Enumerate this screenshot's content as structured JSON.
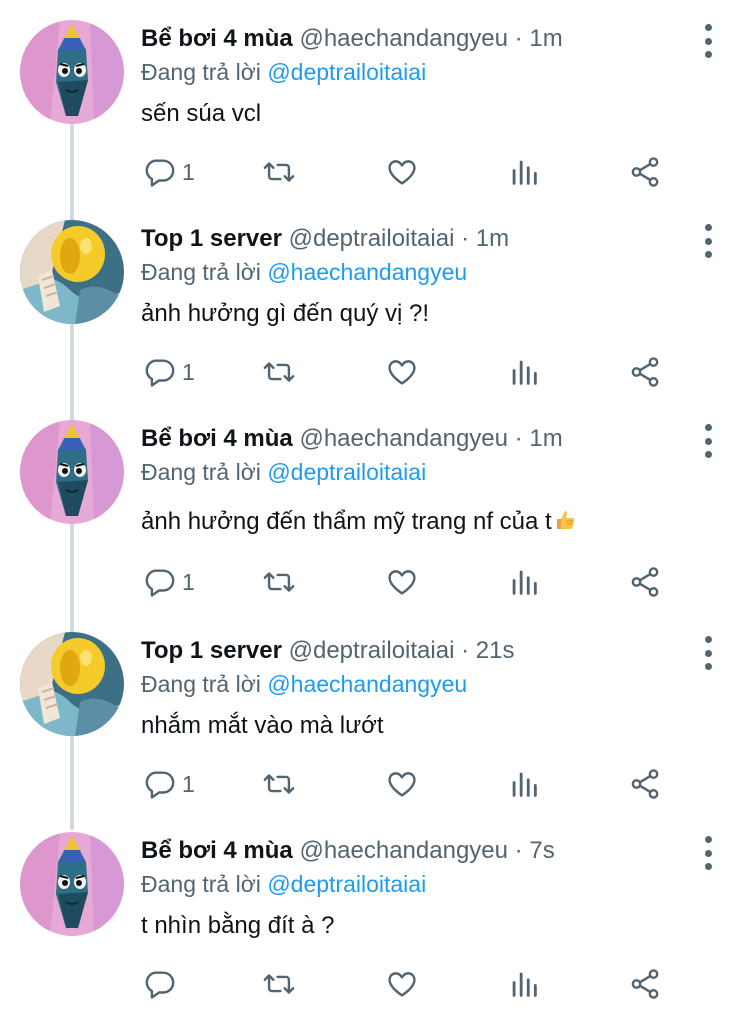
{
  "tweets": [
    {
      "name": "Bể bơi 4 mùa",
      "handle": "@haechandangyeu",
      "time": "1m",
      "reply_prefix": "Đang trả lời",
      "reply_to": "@deptrailoitaiai",
      "text": "sến súa vcl",
      "reply_count": "1",
      "avatar_icon": "fish-avatar-icon"
    },
    {
      "name": "Top 1 server",
      "handle": "@deptrailoitaiai",
      "time": "1m",
      "reply_prefix": "Đang trả lời",
      "reply_to": "@haechandangyeu",
      "text": "ảnh hưởng gì đến quý vị ?!",
      "reply_count": "1",
      "avatar_icon": "emoji-avatar-icon"
    },
    {
      "name": "Bể bơi 4 mùa",
      "handle": "@haechandangyeu",
      "time": "1m",
      "reply_prefix": "Đang trả lời",
      "reply_to": "@deptrailoitaiai",
      "text": "ảnh hưởng đến thẩm mỹ trang nf của t",
      "text_emoji": "thumbs-up-icon",
      "reply_count": "1",
      "avatar_icon": "fish-avatar-icon"
    },
    {
      "name": "Top 1 server",
      "handle": "@deptrailoitaiai",
      "time": "21s",
      "reply_prefix": "Đang trả lời",
      "reply_to": "@haechandangyeu",
      "text": "nhắm mắt vào mà lướt",
      "reply_count": "1",
      "avatar_icon": "emoji-avatar-icon"
    },
    {
      "name": "Bể bơi 4 mùa",
      "handle": "@haechandangyeu",
      "time": "7s",
      "reply_prefix": "Đang trả lời",
      "reply_to": "@deptrailoitaiai",
      "text": "t nhìn bằng đít à ?",
      "reply_count": "",
      "avatar_icon": "fish-avatar-icon"
    }
  ],
  "separator": "·",
  "colors": {
    "link": "#1d9bf0",
    "secondary_text": "#536471",
    "primary_text": "#0f1419",
    "thread_line": "#cfd9de"
  }
}
